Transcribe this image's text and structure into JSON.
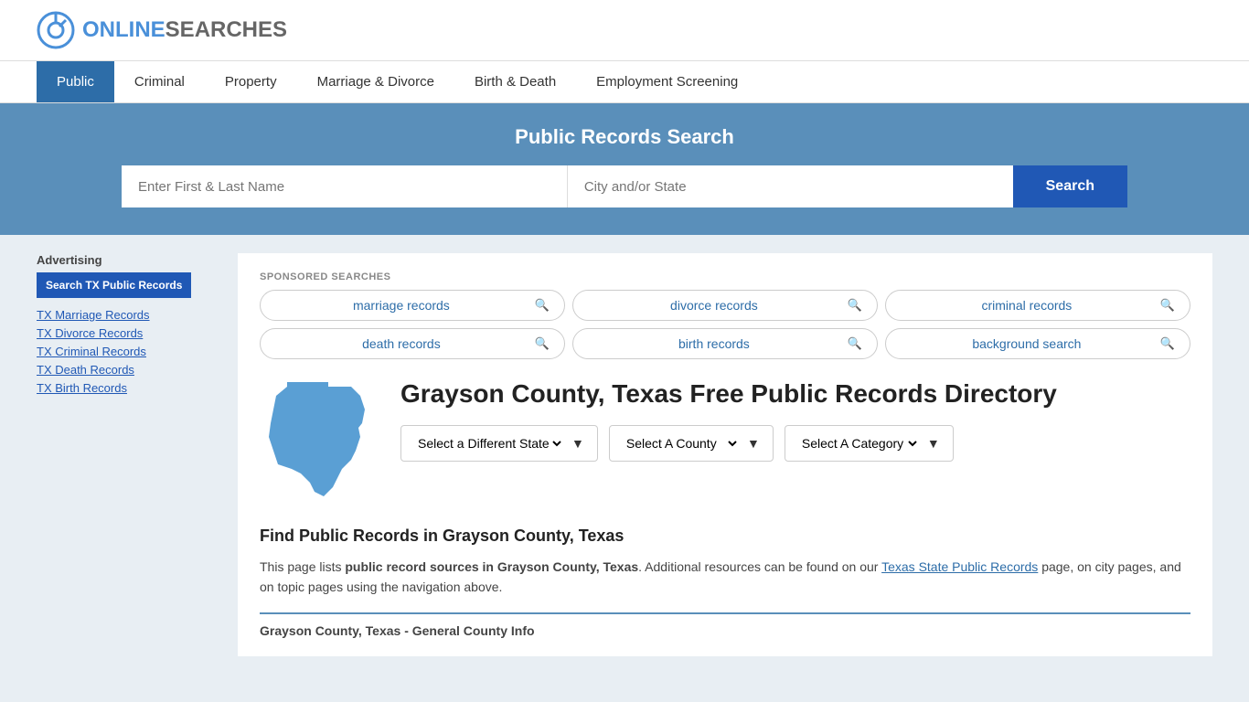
{
  "header": {
    "logo_online": "ONLINE",
    "logo_searches": "SEARCHES"
  },
  "nav": {
    "items": [
      {
        "label": "Public",
        "active": true
      },
      {
        "label": "Criminal",
        "active": false
      },
      {
        "label": "Property",
        "active": false
      },
      {
        "label": "Marriage & Divorce",
        "active": false
      },
      {
        "label": "Birth & Death",
        "active": false
      },
      {
        "label": "Employment Screening",
        "active": false
      }
    ]
  },
  "search": {
    "title": "Public Records Search",
    "name_placeholder": "Enter First & Last Name",
    "location_placeholder": "City and/or State",
    "button_label": "Search"
  },
  "sponsored": {
    "label": "SPONSORED SEARCHES",
    "tags": [
      {
        "label": "marriage records"
      },
      {
        "label": "divorce records"
      },
      {
        "label": "criminal records"
      },
      {
        "label": "death records"
      },
      {
        "label": "birth records"
      },
      {
        "label": "background search"
      }
    ]
  },
  "page": {
    "title": "Grayson County, Texas Free Public Records Directory",
    "find_title": "Find Public Records in Grayson County, Texas",
    "find_text_1": "This page lists ",
    "find_text_bold1": "public record sources in Grayson County, Texas",
    "find_text_2": ". Additional resources can be found on our ",
    "find_link": "Texas State Public Records",
    "find_text_3": " page, on city pages, and on topic pages using the navigation above.",
    "general_info": "Grayson County, Texas - General County Info"
  },
  "dropdowns": {
    "state": "Select a Different State",
    "county": "Select A County",
    "category": "Select A Category"
  },
  "sidebar": {
    "ad_label": "Advertising",
    "ad_btn": "Search TX Public Records",
    "links": [
      {
        "label": "TX Marriage Records"
      },
      {
        "label": "TX Divorce Records"
      },
      {
        "label": "TX Criminal Records"
      },
      {
        "label": "TX Death Records"
      },
      {
        "label": "TX Birth Records"
      }
    ]
  }
}
